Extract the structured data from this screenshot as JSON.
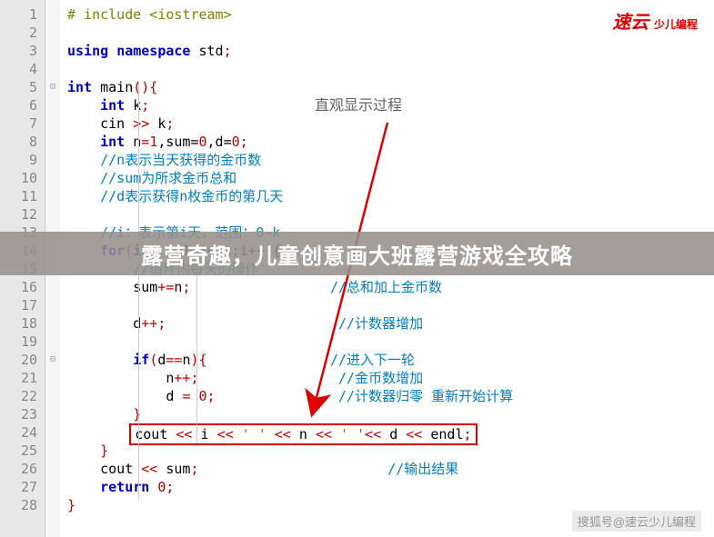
{
  "logo_main": "速云",
  "logo_sub": "少儿编程",
  "annotation": "直观显示过程",
  "banner": "露营奇趣，儿童创意画大班露营游戏全攻略",
  "watermark": "搜狐号@速云少儿编程",
  "lineNumbers": [
    "1",
    "2",
    "3",
    "4",
    "5",
    "6",
    "7",
    "8",
    "9",
    "10",
    "11",
    "12",
    "13",
    "14",
    "15",
    "16",
    "17",
    "18",
    "19",
    "20",
    "21",
    "22",
    "23",
    "24",
    "25",
    "26",
    "27",
    "28"
  ],
  "folds": {
    "5": "⊟",
    "20": "⊟"
  },
  "code": {
    "l1_pp": "# include <iostream>",
    "l3_kw1": "using",
    "l3_kw2": "namespace",
    "l3_id": " std",
    "l3_op": ";",
    "l5_kw": "int",
    "l5_id": " main",
    "l5_op": "(){",
    "l6_kw": "int",
    "l6_id": " k",
    "l6_op": ";",
    "l7_id": "cin ",
    "l7_op": ">>",
    "l7_id2": " k",
    "l7_op2": ";",
    "l8_kw": "int",
    "l8_id": " n",
    "l8_op": "=",
    "l8_n1": "1",
    "l8_c1": ",sum=",
    "l8_n2": "0",
    "l8_c2": ",d=",
    "l8_n3": "0",
    "l8_op2": ";",
    "l9_cmt": "//n表示当天获得的金币数",
    "l10_cmt": "//sum为所求金币总和",
    "l11_cmt": "//d表示获得n枚金币的第几天",
    "l13_cmt": "//i：表示第i天，范围：0~k",
    "l14_kw": "for",
    "l14_op": "(",
    "l14_kw2": "int",
    "l14_rest": " i=1;i<=k;i++){",
    "l15_cmt": "//循环内每天的操作",
    "l16_id": "sum",
    "l16_op": "+=",
    "l16_id2": "n",
    "l16_op2": ";",
    "l16_cmt": "//总和加上金币数",
    "l18_id": "d",
    "l18_op": "++;",
    "l18_cmt": "//计数器增加",
    "l20_kw": "if",
    "l20_op": "(",
    "l20_id": "d",
    "l20_op2": "==",
    "l20_id2": "n",
    "l20_op3": "){",
    "l20_cmt": "//进入下一轮",
    "l21_id": "n",
    "l21_op": "++;",
    "l21_cmt": "//金币数增加",
    "l22_id": "d ",
    "l22_op": "= ",
    "l22_n": "0",
    "l22_op2": ";",
    "l22_cmt": "//计数器归零 重新开始计算",
    "l23_op": "}",
    "l24_id": "cout ",
    "l24_op": "<< ",
    "l24_id2": "i ",
    "l24_op2": "<< ",
    "l24_s1": "' '",
    "l24_op3": " << ",
    "l24_id3": "n ",
    "l24_op4": "<< ",
    "l24_s2": "' '",
    "l24_op5": "<< ",
    "l24_id4": "d ",
    "l24_op6": "<< ",
    "l24_id5": "endl",
    "l24_op7": ";",
    "l25_op": "}",
    "l26_id": "cout ",
    "l26_op": "<<",
    "l26_id2": " sum",
    "l26_op2": ";",
    "l26_cmt": "//输出结果",
    "l27_kw": "return",
    "l27_n": " 0",
    "l27_op": ";",
    "l28_op": "}"
  }
}
